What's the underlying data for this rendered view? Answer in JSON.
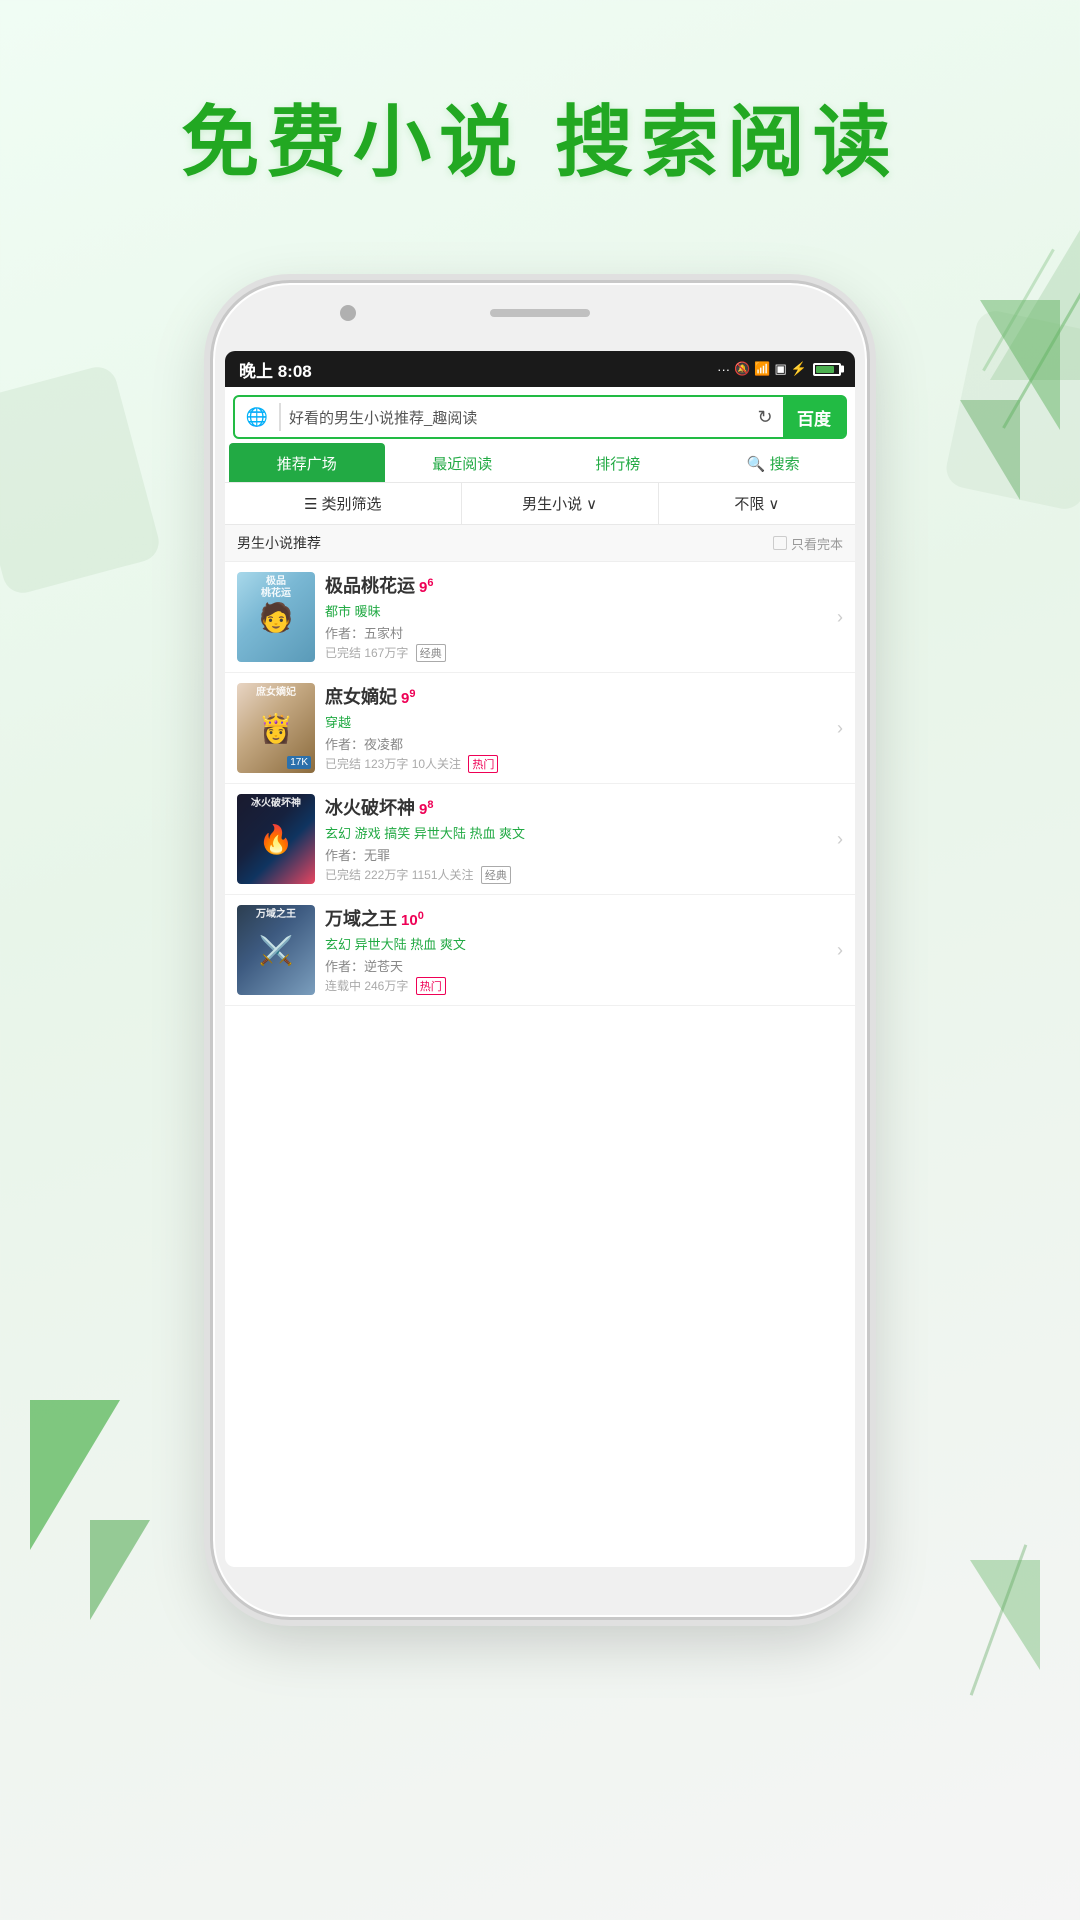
{
  "app": {
    "headline": "免费小说  搜索阅读"
  },
  "status_bar": {
    "time": "晚上 8:08",
    "icons": "... 🔕 ⟳ ▣ ⚡"
  },
  "browser": {
    "url": "好看的男生小说推荐_趣阅读",
    "baidu_label": "百度"
  },
  "nav_tabs": [
    {
      "id": "recommend",
      "label": "推荐广场",
      "active": true
    },
    {
      "id": "recent",
      "label": "最近阅读",
      "active": false
    },
    {
      "id": "rank",
      "label": "排行榜",
      "active": false
    },
    {
      "id": "search",
      "label": "搜索",
      "active": false,
      "has_icon": true
    }
  ],
  "filter_bar": {
    "category": "类别筛选",
    "genre": "男生小说",
    "limit": "不限"
  },
  "section": {
    "title": "男生小说推荐",
    "filter_label": "只看完本"
  },
  "books": [
    {
      "id": 1,
      "title": "极品桃花运",
      "rating": "9",
      "rating_sup": "6",
      "tags": "都市 暖昧",
      "author": "作者：五家村",
      "stats": "已完结 167万字",
      "badge": "经典",
      "badge_type": "normal",
      "cover_label": "极品桃花运"
    },
    {
      "id": 2,
      "title": "庶女嫡妃",
      "rating": "9",
      "rating_sup": "9",
      "tags": "穿越",
      "author": "作者：夜凌都",
      "stats": "已完结 123万字 10人关注",
      "badge": "热门",
      "badge_type": "hot",
      "cover_label": "庶女嫡妃"
    },
    {
      "id": 3,
      "title": "冰火破坏神",
      "rating": "9",
      "rating_sup": "8",
      "tags": "玄幻 游戏 搞笑 异世大陆 热血 爽文",
      "author": "作者：无罪",
      "stats": "已完结 222万字 1151人关注",
      "badge": "经典",
      "badge_type": "normal",
      "cover_label": "冰火破坏神"
    },
    {
      "id": 4,
      "title": "万域之王",
      "rating": "10",
      "rating_sup": "0",
      "tags": "玄幻 异世大陆 热血 爽文",
      "author": "作者：逆苍天",
      "stats": "连载中 246万字",
      "badge": "热门",
      "badge_type": "hot",
      "cover_label": "万域之王"
    }
  ],
  "icons": {
    "globe": "🌐",
    "refresh": "↻",
    "search": "🔍",
    "list": "≡",
    "chevron_down": "∨",
    "chevron_right": "›",
    "checkbox_empty": "□"
  }
}
